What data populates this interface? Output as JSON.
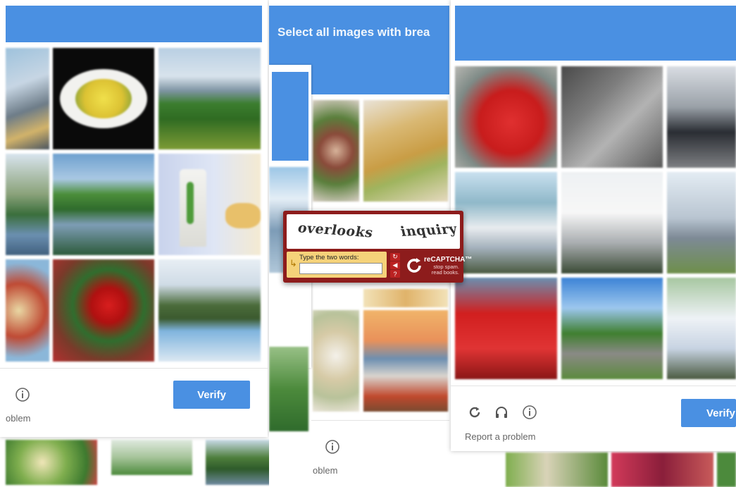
{
  "middle_panel": {
    "header_prefix": "Select all images with ",
    "header_emphasis": "brea"
  },
  "left_panel": {
    "verify_label": "Verify",
    "report_label": "oblem",
    "icons": [
      "info-icon"
    ]
  },
  "middle_bottom": {
    "report_label": "oblem",
    "icons": [
      "info-icon"
    ]
  },
  "right_panel": {
    "verify_label": "Verify",
    "report_label": "Report a problem",
    "icons": [
      "reload-icon",
      "headphones-icon",
      "info-icon"
    ]
  },
  "recaptcha_v1": {
    "word_1": "overlooks",
    "word_2": "inquiry",
    "prompt": "Type the two words:",
    "input_value": "",
    "brand": "reCAPTCHA™",
    "tagline_1": "stop spam.",
    "tagline_2": "read books.",
    "buttons": [
      "reload-icon",
      "audio-icon",
      "help-icon"
    ]
  },
  "colors": {
    "accent_blue": "#4a90e2",
    "recaptcha_red": "#8d1c1c",
    "recaptcha_yellow": "#f5d27a"
  }
}
